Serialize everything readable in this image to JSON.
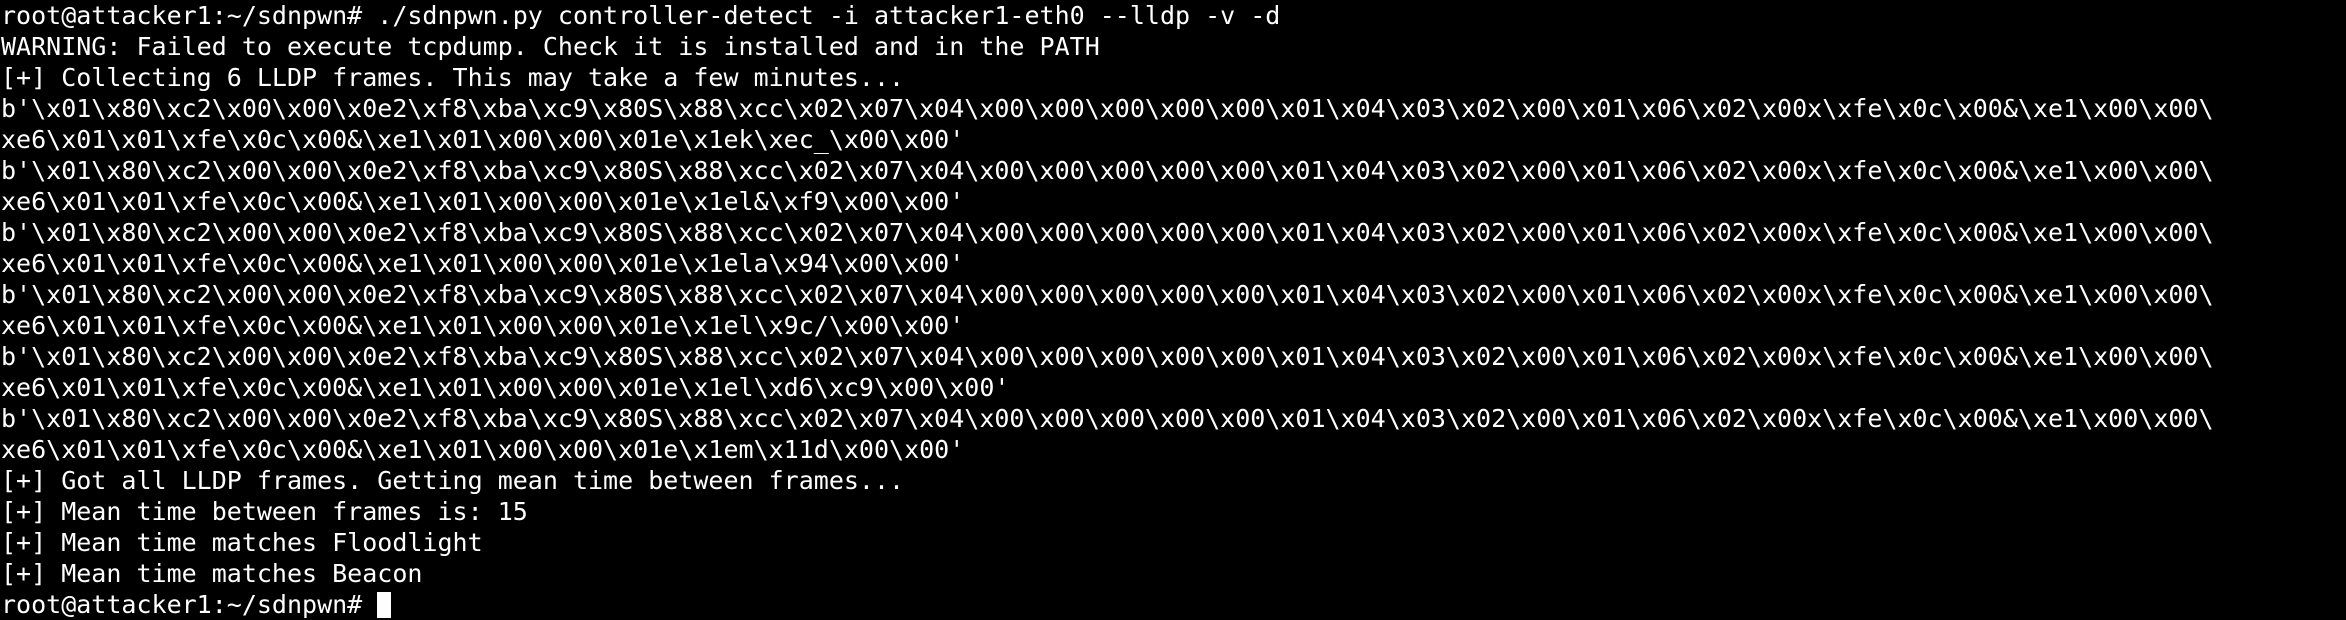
{
  "terminal": {
    "lines": [
      "root@attacker1:~/sdnpwn# ./sdnpwn.py controller-detect -i attacker1-eth0 --lldp -v -d",
      "WARNING: Failed to execute tcpdump. Check it is installed and in the PATH",
      "[+] Collecting 6 LLDP frames. This may take a few minutes...",
      "b'\\x01\\x80\\xc2\\x00\\x00\\x0e2\\xf8\\xba\\xc9\\x80S\\x88\\xcc\\x02\\x07\\x04\\x00\\x00\\x00\\x00\\x00\\x01\\x04\\x03\\x02\\x00\\x01\\x06\\x02\\x00x\\xfe\\x0c\\x00&\\xe1\\x00\\x00\\",
      "xe6\\x01\\x01\\xfe\\x0c\\x00&\\xe1\\x01\\x00\\x00\\x01e\\x1ek\\xec_\\x00\\x00'",
      "b'\\x01\\x80\\xc2\\x00\\x00\\x0e2\\xf8\\xba\\xc9\\x80S\\x88\\xcc\\x02\\x07\\x04\\x00\\x00\\x00\\x00\\x00\\x01\\x04\\x03\\x02\\x00\\x01\\x06\\x02\\x00x\\xfe\\x0c\\x00&\\xe1\\x00\\x00\\",
      "xe6\\x01\\x01\\xfe\\x0c\\x00&\\xe1\\x01\\x00\\x00\\x01e\\x1el&\\xf9\\x00\\x00'",
      "b'\\x01\\x80\\xc2\\x00\\x00\\x0e2\\xf8\\xba\\xc9\\x80S\\x88\\xcc\\x02\\x07\\x04\\x00\\x00\\x00\\x00\\x00\\x01\\x04\\x03\\x02\\x00\\x01\\x06\\x02\\x00x\\xfe\\x0c\\x00&\\xe1\\x00\\x00\\",
      "xe6\\x01\\x01\\xfe\\x0c\\x00&\\xe1\\x01\\x00\\x00\\x01e\\x1ela\\x94\\x00\\x00'",
      "b'\\x01\\x80\\xc2\\x00\\x00\\x0e2\\xf8\\xba\\xc9\\x80S\\x88\\xcc\\x02\\x07\\x04\\x00\\x00\\x00\\x00\\x00\\x01\\x04\\x03\\x02\\x00\\x01\\x06\\x02\\x00x\\xfe\\x0c\\x00&\\xe1\\x00\\x00\\",
      "xe6\\x01\\x01\\xfe\\x0c\\x00&\\xe1\\x01\\x00\\x00\\x01e\\x1el\\x9c/\\x00\\x00'",
      "b'\\x01\\x80\\xc2\\x00\\x00\\x0e2\\xf8\\xba\\xc9\\x80S\\x88\\xcc\\x02\\x07\\x04\\x00\\x00\\x00\\x00\\x00\\x01\\x04\\x03\\x02\\x00\\x01\\x06\\x02\\x00x\\xfe\\x0c\\x00&\\xe1\\x00\\x00\\",
      "xe6\\x01\\x01\\xfe\\x0c\\x00&\\xe1\\x01\\x00\\x00\\x01e\\x1el\\xd6\\xc9\\x00\\x00'",
      "b'\\x01\\x80\\xc2\\x00\\x00\\x0e2\\xf8\\xba\\xc9\\x80S\\x88\\xcc\\x02\\x07\\x04\\x00\\x00\\x00\\x00\\x00\\x01\\x04\\x03\\x02\\x00\\x01\\x06\\x02\\x00x\\xfe\\x0c\\x00&\\xe1\\x00\\x00\\",
      "xe6\\x01\\x01\\xfe\\x0c\\x00&\\xe1\\x01\\x00\\x00\\x01e\\x1em\\x11d\\x00\\x00'",
      "[+] Got all LLDP frames. Getting mean time between frames...",
      "[+] Mean time between frames is: 15",
      "[+] Mean time matches Floodlight",
      "[+] Mean time matches Beacon"
    ],
    "prompt": "root@attacker1:~/sdnpwn# ",
    "colors": {
      "background": "#000000",
      "foreground": "#ffffff"
    }
  }
}
